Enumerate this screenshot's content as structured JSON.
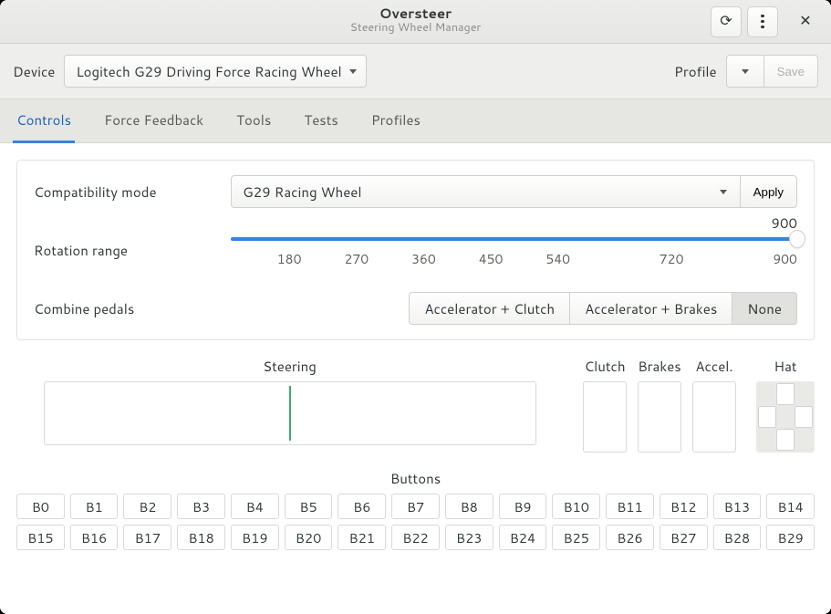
{
  "titlebar": {
    "title": "Oversteer",
    "subtitle": "Steering Wheel Manager"
  },
  "toolbar": {
    "device_label": "Device",
    "device_value": "Logitech G29 Driving Force Racing Wheel",
    "profile_label": "Profile",
    "save_label": "Save"
  },
  "tabs": [
    "Controls",
    "Force Feedback",
    "Tools",
    "Tests",
    "Profiles"
  ],
  "active_tab": 0,
  "compat": {
    "label": "Compatibility mode",
    "value": "G29 Racing Wheel",
    "apply": "Apply"
  },
  "rotation": {
    "label": "Rotation range",
    "value": "900",
    "ticks": [
      "",
      "180",
      "270",
      "360",
      "450",
      "540",
      "",
      "720",
      "",
      "900"
    ]
  },
  "combine": {
    "label": "Combine pedals",
    "options": [
      "Accelerator + Clutch",
      "Accelerator + Brakes",
      "None"
    ],
    "active": 2
  },
  "preview": {
    "steering": "Steering",
    "clutch": "Clutch",
    "brakes": "Brakes",
    "accel": "Accel.",
    "hat": "Hat"
  },
  "buttons_label": "Buttons",
  "buttons": [
    "B0",
    "B1",
    "B2",
    "B3",
    "B4",
    "B5",
    "B6",
    "B7",
    "B8",
    "B9",
    "B10",
    "B11",
    "B12",
    "B13",
    "B14",
    "B15",
    "B16",
    "B17",
    "B18",
    "B19",
    "B20",
    "B21",
    "B22",
    "B23",
    "B24",
    "B25",
    "B26",
    "B27",
    "B28",
    "B29"
  ]
}
